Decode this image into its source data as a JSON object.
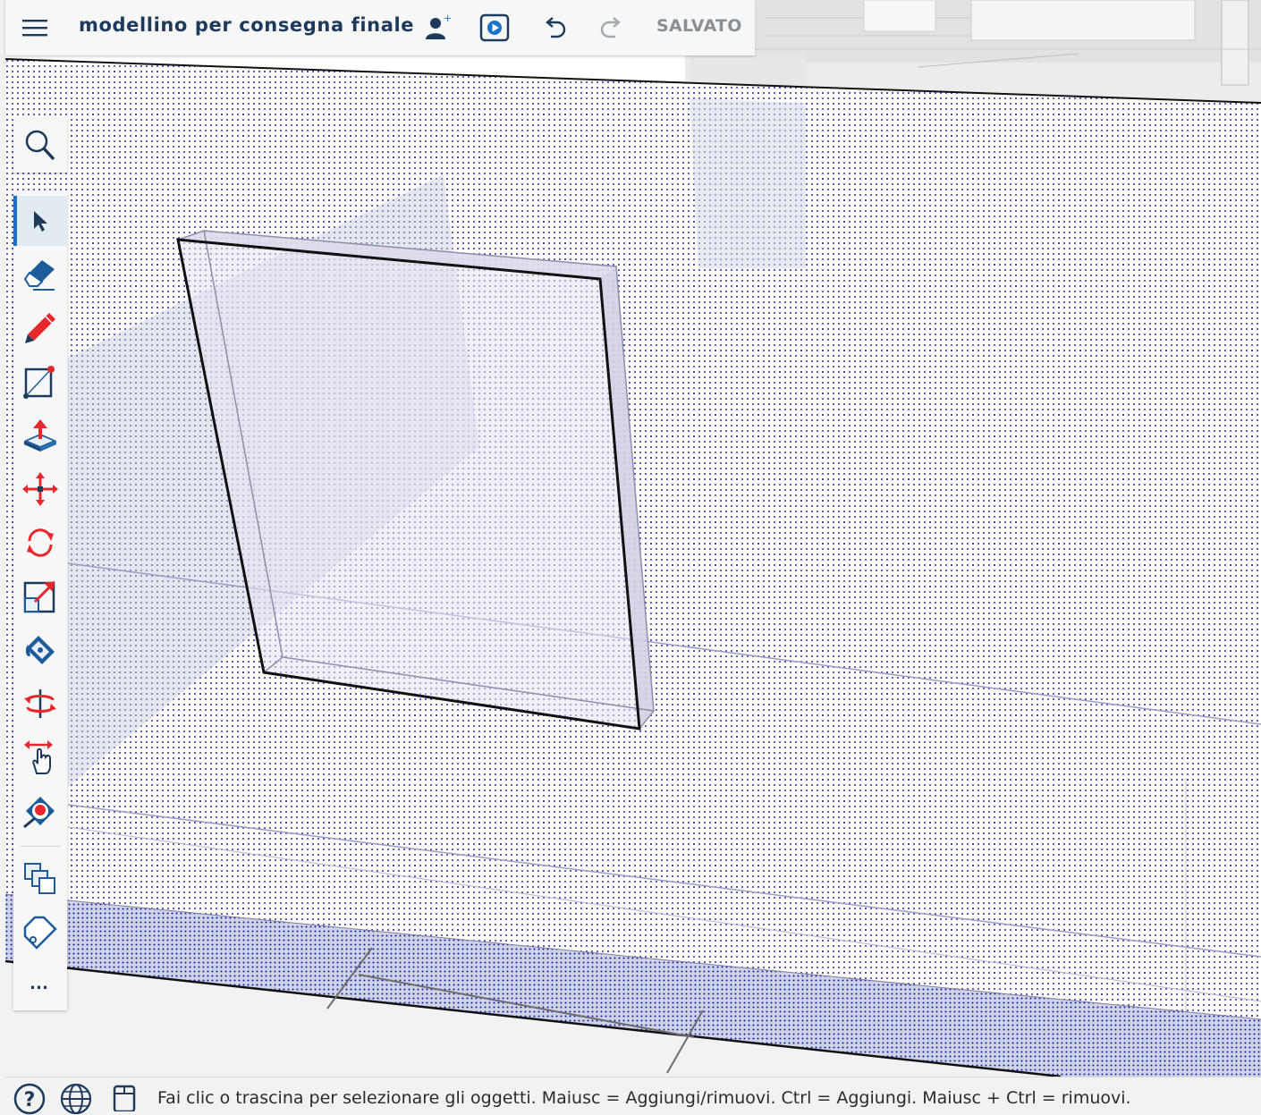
{
  "header": {
    "model_title": "modellino per consegna finale",
    "saved_status": "SALVATO",
    "icons": [
      "menu-icon",
      "add-collaborator-icon",
      "present-play-icon",
      "undo-icon",
      "redo-icon"
    ]
  },
  "toolbar": {
    "active_tool": "select",
    "tools": [
      "search",
      "select",
      "eraser",
      "line",
      "shapes",
      "push-pull",
      "move",
      "rotate",
      "scale",
      "paint",
      "orbit",
      "pan",
      "tape-measure",
      "components",
      "tag"
    ],
    "more_label": "…"
  },
  "statusbar": {
    "hint_text": "Fai clic o trascina per selezionare gli oggetti. Maiusc = Aggiungi/rimuovi. Ctrl = Aggiungi. Maiusc + Ctrl = rimuovi.",
    "icons": [
      "help-icon",
      "geo-location-icon",
      "credits-icon"
    ]
  },
  "colors": {
    "accent": "#1a73c9",
    "title_text": "#1d3a5c",
    "status_gray": "#8b8f94",
    "tool_red": "#e5282b",
    "tool_blue": "#1d5c9b",
    "hatch_dots": "#1a1aa8"
  }
}
